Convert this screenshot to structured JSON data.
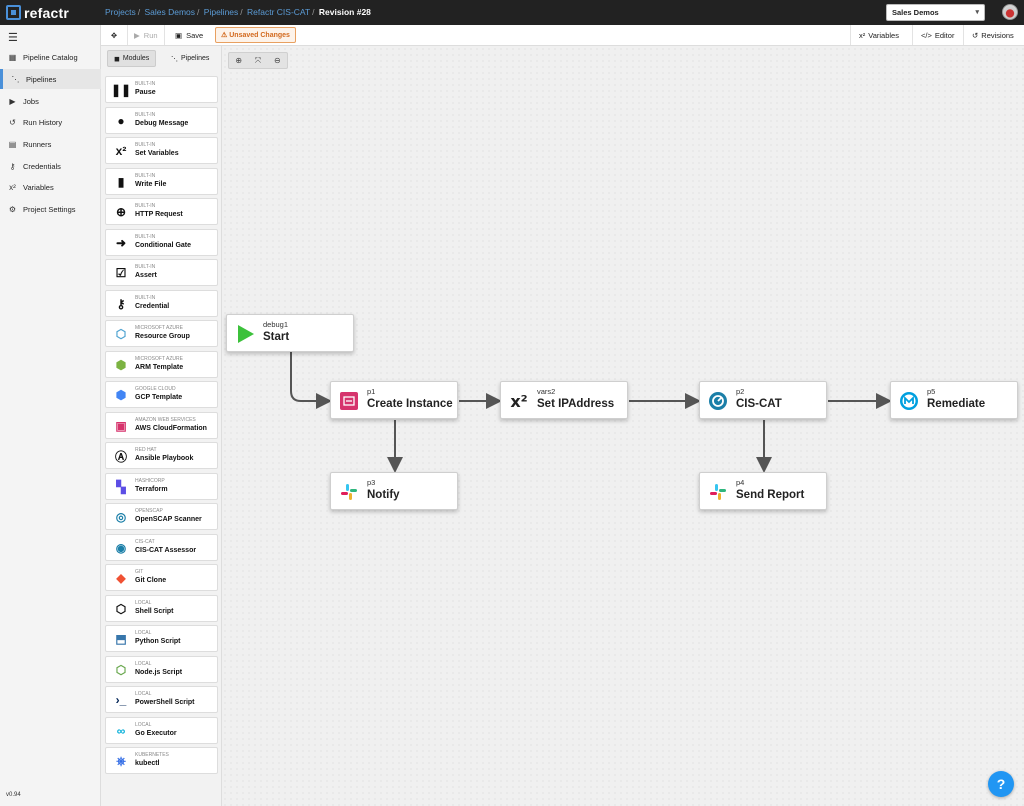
{
  "app": {
    "logo": "refactr"
  },
  "breadcrumb": [
    "Projects",
    "Sales Demos",
    "Pipelines",
    "Refactr CIS-CAT",
    "Revision #28"
  ],
  "org_select": {
    "value": "Sales Demos"
  },
  "sidebar": {
    "items": [
      {
        "label": "Pipeline Catalog",
        "icon": "grid-icon"
      },
      {
        "label": "Pipelines",
        "icon": "pipeline-icon"
      },
      {
        "label": "Jobs",
        "icon": "play-circle-icon"
      },
      {
        "label": "Run History",
        "icon": "history-icon"
      },
      {
        "label": "Runners",
        "icon": "server-icon"
      },
      {
        "label": "Credentials",
        "icon": "key-icon"
      },
      {
        "label": "Variables",
        "icon": "superscript-icon"
      },
      {
        "label": "Project Settings",
        "icon": "gear-icon"
      }
    ],
    "active": "Pipelines",
    "version": "v0.94"
  },
  "toolbar": {
    "run_label": "Run",
    "save_label": "Save",
    "unsaved_label": "Unsaved Changes",
    "variables_label": "Variables",
    "editor_label": "Editor",
    "revisions_label": "Revisions"
  },
  "panel": {
    "tabs": [
      "Modules",
      "Pipelines"
    ],
    "modules": [
      {
        "category": "BUILT-IN",
        "name": "Pause",
        "icon": "pause-icon"
      },
      {
        "category": "BUILT-IN",
        "name": "Debug Message",
        "icon": "speech-bubble-icon"
      },
      {
        "category": "BUILT-IN",
        "name": "Set Variables",
        "icon": "superscript-icon"
      },
      {
        "category": "BUILT-IN",
        "name": "Write File",
        "icon": "file-icon"
      },
      {
        "category": "BUILT-IN",
        "name": "HTTP Request",
        "icon": "globe-icon"
      },
      {
        "category": "BUILT-IN",
        "name": "Conditional Gate",
        "icon": "gate-icon"
      },
      {
        "category": "BUILT-IN",
        "name": "Assert",
        "icon": "checkbox-icon"
      },
      {
        "category": "BUILT-IN",
        "name": "Credential",
        "icon": "key-icon"
      },
      {
        "category": "MICROSOFT AZURE",
        "name": "Resource Group",
        "icon": "azure-cube-icon"
      },
      {
        "category": "MICROSOFT AZURE",
        "name": "ARM Template",
        "icon": "azure-cubes-icon"
      },
      {
        "category": "GOOGLE CLOUD",
        "name": "GCP Template",
        "icon": "gcp-icon"
      },
      {
        "category": "AMAZON WEB SERVICES",
        "name": "AWS CloudFormation",
        "icon": "aws-icon"
      },
      {
        "category": "RED HAT",
        "name": "Ansible Playbook",
        "icon": "ansible-icon"
      },
      {
        "category": "HASHICORP",
        "name": "Terraform",
        "icon": "terraform-icon"
      },
      {
        "category": "OPENSCAP",
        "name": "OpenSCAP Scanner",
        "icon": "openscap-icon"
      },
      {
        "category": "CIS-CAT",
        "name": "CIS-CAT Assessor",
        "icon": "gauge-icon"
      },
      {
        "category": "GIT",
        "name": "Git Clone",
        "icon": "git-icon"
      },
      {
        "category": "LOCAL",
        "name": "Shell Script",
        "icon": "cube-icon"
      },
      {
        "category": "LOCAL",
        "name": "Python Script",
        "icon": "python-icon"
      },
      {
        "category": "LOCAL",
        "name": "Node.js Script",
        "icon": "nodejs-icon"
      },
      {
        "category": "LOCAL",
        "name": "PowerShell Script",
        "icon": "powershell-icon"
      },
      {
        "category": "LOCAL",
        "name": "Go Executor",
        "icon": "go-icon"
      },
      {
        "category": "KUBERNETES",
        "name": "kubectl",
        "icon": "kubernetes-icon"
      }
    ]
  },
  "canvas": {
    "nodes": [
      {
        "id": "debug1",
        "title": "Start",
        "icon": "play-icon"
      },
      {
        "id": "p1",
        "title": "Create Instance",
        "icon": "aws-icon"
      },
      {
        "id": "vars2",
        "title": "Set IPAddress",
        "icon": "superscript-icon"
      },
      {
        "id": "p2",
        "title": "CIS-CAT",
        "icon": "gauge-icon"
      },
      {
        "id": "p5",
        "title": "Remediate",
        "icon": "mulesoft-icon"
      },
      {
        "id": "p3",
        "title": "Notify",
        "icon": "slack-icon"
      },
      {
        "id": "p4",
        "title": "Send Report",
        "icon": "slack-icon"
      }
    ],
    "edges": [
      [
        "debug1",
        "p1"
      ],
      [
        "p1",
        "vars2"
      ],
      [
        "vars2",
        "p2"
      ],
      [
        "p2",
        "p5"
      ],
      [
        "p1",
        "p3"
      ],
      [
        "p2",
        "p4"
      ]
    ]
  },
  "help": {
    "label": "?"
  },
  "colors": {
    "accent": "#4a90d9",
    "topbar": "#222222",
    "warning": "#d2691e",
    "start_green": "#3cc13b",
    "help": "#2196f3"
  }
}
